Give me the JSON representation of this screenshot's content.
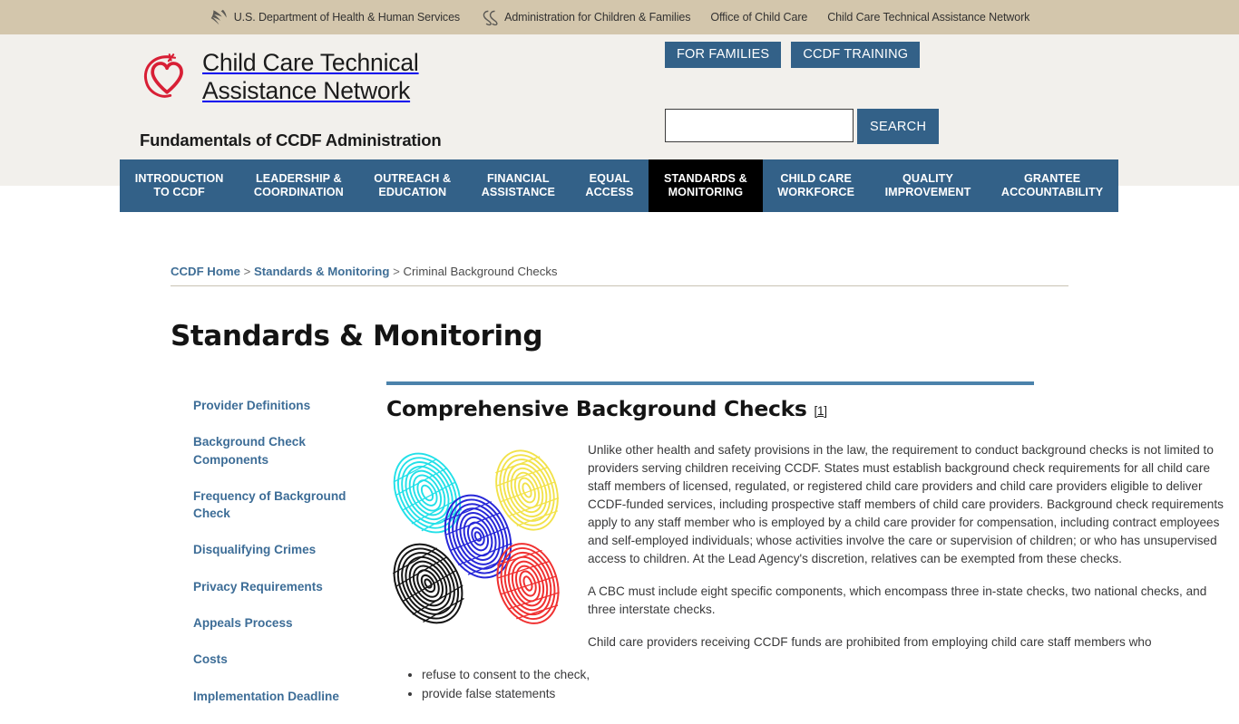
{
  "colors": {
    "fed_bar_bg": "#d3c6ac",
    "header_bg": "#f2f0ec",
    "accent_blue": "#336188",
    "active_nav_bg": "#000000",
    "link_blue": "#3d6d97",
    "rule_blue": "#4b82ab",
    "logo_red": "#d81f35"
  },
  "fed_bar": {
    "links": [
      {
        "label": "U.S. Department of Health & Human Services",
        "icon": "hhs-logo-icon"
      },
      {
        "label": "Administration for Children & Families",
        "icon": "acf-logo-icon"
      },
      {
        "label": "Office of Child Care",
        "icon": ""
      },
      {
        "label": "Child Care Technical Assistance Network",
        "icon": ""
      }
    ]
  },
  "header": {
    "logo_icon": "heart-swoosh-logo",
    "brand_line1": "Child Care Technical",
    "brand_line2": "Assistance Network",
    "tagline": "Fundamentals of CCDF Administration",
    "buttons": [
      {
        "label": "FOR FAMILIES",
        "name": "for-families-button"
      },
      {
        "label": "CCDF TRAINING",
        "name": "ccdf-training-button"
      }
    ],
    "search": {
      "value": "",
      "placeholder": "",
      "button_label": "SEARCH"
    }
  },
  "nav": {
    "items": [
      {
        "line1": "INTRODUCTION",
        "line2": "TO CCDF",
        "active": false,
        "name": "nav-introduction-to-ccdf"
      },
      {
        "line1": "LEADERSHIP &",
        "line2": "COORDINATION",
        "active": false,
        "name": "nav-leadership-coordination"
      },
      {
        "line1": "OUTREACH &",
        "line2": "EDUCATION",
        "active": false,
        "name": "nav-outreach-education"
      },
      {
        "line1": "FINANCIAL",
        "line2": "ASSISTANCE",
        "active": false,
        "name": "nav-financial-assistance"
      },
      {
        "line1": "EQUAL",
        "line2": "ACCESS",
        "active": false,
        "name": "nav-equal-access"
      },
      {
        "line1": "STANDARDS &",
        "line2": "MONITORING",
        "active": true,
        "name": "nav-standards-monitoring"
      },
      {
        "line1": "CHILD CARE",
        "line2": "WORKFORCE",
        "active": false,
        "name": "nav-child-care-workforce"
      },
      {
        "line1": "QUALITY",
        "line2": "IMPROVEMENT",
        "active": false,
        "name": "nav-quality-improvement"
      },
      {
        "line1": "GRANTEE",
        "line2": "ACCOUNTABILITY",
        "active": false,
        "name": "nav-grantee-accountability"
      }
    ]
  },
  "breadcrumb": {
    "home": "CCDF Home",
    "sep1": " > ",
    "section": "Standards & Monitoring",
    "sep2": " > ",
    "current": "Criminal Background Checks"
  },
  "page_title": "Standards & Monitoring",
  "sidebar": {
    "items": [
      {
        "label": "Provider Definitions"
      },
      {
        "label": "Background Check Components"
      },
      {
        "label": "Frequency of Background Check"
      },
      {
        "label": "Disqualifying Crimes"
      },
      {
        "label": "Privacy Requirements"
      },
      {
        "label": "Appeals Process"
      },
      {
        "label": "Costs"
      },
      {
        "label": "Implementation Deadline"
      }
    ]
  },
  "main": {
    "heading": "Comprehensive Background Checks",
    "footnote_open": "[",
    "footnote_number": "1",
    "footnote_close": "]",
    "image_alt": "fingerprints-illustration",
    "paragraph1": "Unlike other health and safety provisions in the law, the requirement to conduct background checks is not limited to providers serving children receiving CCDF. States must establish background check requirements for all child care staff members of licensed, regulated, or registered child care providers and child care providers eligible to deliver CCDF-funded services, including prospective staff members of child care providers. Background check requirements apply to any staff member who is employed by a child care provider for compensation, including contract employees and self-employed individuals; whose activities involve the care or supervision of children; or who has unsupervised access to children. At the Lead Agency's discretion, relatives can be exempted from these checks.",
    "paragraph2": "A CBC must include eight specific components, which encompass three in-state checks, two national checks, and three interstate checks.",
    "paragraph3": "Child care providers receiving CCDF funds are prohibited from employing child care staff members who",
    "list": [
      "refuse to consent to the check,",
      "provide false statements"
    ]
  }
}
